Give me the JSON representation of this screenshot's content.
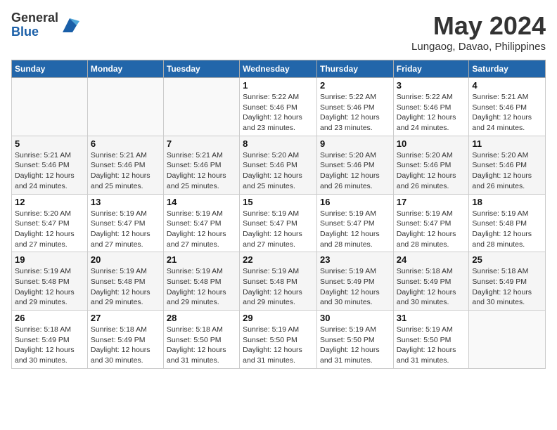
{
  "header": {
    "logo_general": "General",
    "logo_blue": "Blue",
    "month_title": "May 2024",
    "location": "Lungaog, Davao, Philippines"
  },
  "weekdays": [
    "Sunday",
    "Monday",
    "Tuesday",
    "Wednesday",
    "Thursday",
    "Friday",
    "Saturday"
  ],
  "weeks": [
    [
      {
        "day": "",
        "sunrise": "",
        "sunset": "",
        "daylight": ""
      },
      {
        "day": "",
        "sunrise": "",
        "sunset": "",
        "daylight": ""
      },
      {
        "day": "",
        "sunrise": "",
        "sunset": "",
        "daylight": ""
      },
      {
        "day": "1",
        "sunrise": "Sunrise: 5:22 AM",
        "sunset": "Sunset: 5:46 PM",
        "daylight": "Daylight: 12 hours and 23 minutes."
      },
      {
        "day": "2",
        "sunrise": "Sunrise: 5:22 AM",
        "sunset": "Sunset: 5:46 PM",
        "daylight": "Daylight: 12 hours and 23 minutes."
      },
      {
        "day": "3",
        "sunrise": "Sunrise: 5:22 AM",
        "sunset": "Sunset: 5:46 PM",
        "daylight": "Daylight: 12 hours and 24 minutes."
      },
      {
        "day": "4",
        "sunrise": "Sunrise: 5:21 AM",
        "sunset": "Sunset: 5:46 PM",
        "daylight": "Daylight: 12 hours and 24 minutes."
      }
    ],
    [
      {
        "day": "5",
        "sunrise": "Sunrise: 5:21 AM",
        "sunset": "Sunset: 5:46 PM",
        "daylight": "Daylight: 12 hours and 24 minutes."
      },
      {
        "day": "6",
        "sunrise": "Sunrise: 5:21 AM",
        "sunset": "Sunset: 5:46 PM",
        "daylight": "Daylight: 12 hours and 25 minutes."
      },
      {
        "day": "7",
        "sunrise": "Sunrise: 5:21 AM",
        "sunset": "Sunset: 5:46 PM",
        "daylight": "Daylight: 12 hours and 25 minutes."
      },
      {
        "day": "8",
        "sunrise": "Sunrise: 5:20 AM",
        "sunset": "Sunset: 5:46 PM",
        "daylight": "Daylight: 12 hours and 25 minutes."
      },
      {
        "day": "9",
        "sunrise": "Sunrise: 5:20 AM",
        "sunset": "Sunset: 5:46 PM",
        "daylight": "Daylight: 12 hours and 26 minutes."
      },
      {
        "day": "10",
        "sunrise": "Sunrise: 5:20 AM",
        "sunset": "Sunset: 5:46 PM",
        "daylight": "Daylight: 12 hours and 26 minutes."
      },
      {
        "day": "11",
        "sunrise": "Sunrise: 5:20 AM",
        "sunset": "Sunset: 5:46 PM",
        "daylight": "Daylight: 12 hours and 26 minutes."
      }
    ],
    [
      {
        "day": "12",
        "sunrise": "Sunrise: 5:20 AM",
        "sunset": "Sunset: 5:47 PM",
        "daylight": "Daylight: 12 hours and 27 minutes."
      },
      {
        "day": "13",
        "sunrise": "Sunrise: 5:19 AM",
        "sunset": "Sunset: 5:47 PM",
        "daylight": "Daylight: 12 hours and 27 minutes."
      },
      {
        "day": "14",
        "sunrise": "Sunrise: 5:19 AM",
        "sunset": "Sunset: 5:47 PM",
        "daylight": "Daylight: 12 hours and 27 minutes."
      },
      {
        "day": "15",
        "sunrise": "Sunrise: 5:19 AM",
        "sunset": "Sunset: 5:47 PM",
        "daylight": "Daylight: 12 hours and 27 minutes."
      },
      {
        "day": "16",
        "sunrise": "Sunrise: 5:19 AM",
        "sunset": "Sunset: 5:47 PM",
        "daylight": "Daylight: 12 hours and 28 minutes."
      },
      {
        "day": "17",
        "sunrise": "Sunrise: 5:19 AM",
        "sunset": "Sunset: 5:47 PM",
        "daylight": "Daylight: 12 hours and 28 minutes."
      },
      {
        "day": "18",
        "sunrise": "Sunrise: 5:19 AM",
        "sunset": "Sunset: 5:48 PM",
        "daylight": "Daylight: 12 hours and 28 minutes."
      }
    ],
    [
      {
        "day": "19",
        "sunrise": "Sunrise: 5:19 AM",
        "sunset": "Sunset: 5:48 PM",
        "daylight": "Daylight: 12 hours and 29 minutes."
      },
      {
        "day": "20",
        "sunrise": "Sunrise: 5:19 AM",
        "sunset": "Sunset: 5:48 PM",
        "daylight": "Daylight: 12 hours and 29 minutes."
      },
      {
        "day": "21",
        "sunrise": "Sunrise: 5:19 AM",
        "sunset": "Sunset: 5:48 PM",
        "daylight": "Daylight: 12 hours and 29 minutes."
      },
      {
        "day": "22",
        "sunrise": "Sunrise: 5:19 AM",
        "sunset": "Sunset: 5:48 PM",
        "daylight": "Daylight: 12 hours and 29 minutes."
      },
      {
        "day": "23",
        "sunrise": "Sunrise: 5:19 AM",
        "sunset": "Sunset: 5:49 PM",
        "daylight": "Daylight: 12 hours and 30 minutes."
      },
      {
        "day": "24",
        "sunrise": "Sunrise: 5:18 AM",
        "sunset": "Sunset: 5:49 PM",
        "daylight": "Daylight: 12 hours and 30 minutes."
      },
      {
        "day": "25",
        "sunrise": "Sunrise: 5:18 AM",
        "sunset": "Sunset: 5:49 PM",
        "daylight": "Daylight: 12 hours and 30 minutes."
      }
    ],
    [
      {
        "day": "26",
        "sunrise": "Sunrise: 5:18 AM",
        "sunset": "Sunset: 5:49 PM",
        "daylight": "Daylight: 12 hours and 30 minutes."
      },
      {
        "day": "27",
        "sunrise": "Sunrise: 5:18 AM",
        "sunset": "Sunset: 5:49 PM",
        "daylight": "Daylight: 12 hours and 30 minutes."
      },
      {
        "day": "28",
        "sunrise": "Sunrise: 5:18 AM",
        "sunset": "Sunset: 5:50 PM",
        "daylight": "Daylight: 12 hours and 31 minutes."
      },
      {
        "day": "29",
        "sunrise": "Sunrise: 5:19 AM",
        "sunset": "Sunset: 5:50 PM",
        "daylight": "Daylight: 12 hours and 31 minutes."
      },
      {
        "day": "30",
        "sunrise": "Sunrise: 5:19 AM",
        "sunset": "Sunset: 5:50 PM",
        "daylight": "Daylight: 12 hours and 31 minutes."
      },
      {
        "day": "31",
        "sunrise": "Sunrise: 5:19 AM",
        "sunset": "Sunset: 5:50 PM",
        "daylight": "Daylight: 12 hours and 31 minutes."
      },
      {
        "day": "",
        "sunrise": "",
        "sunset": "",
        "daylight": ""
      }
    ]
  ]
}
